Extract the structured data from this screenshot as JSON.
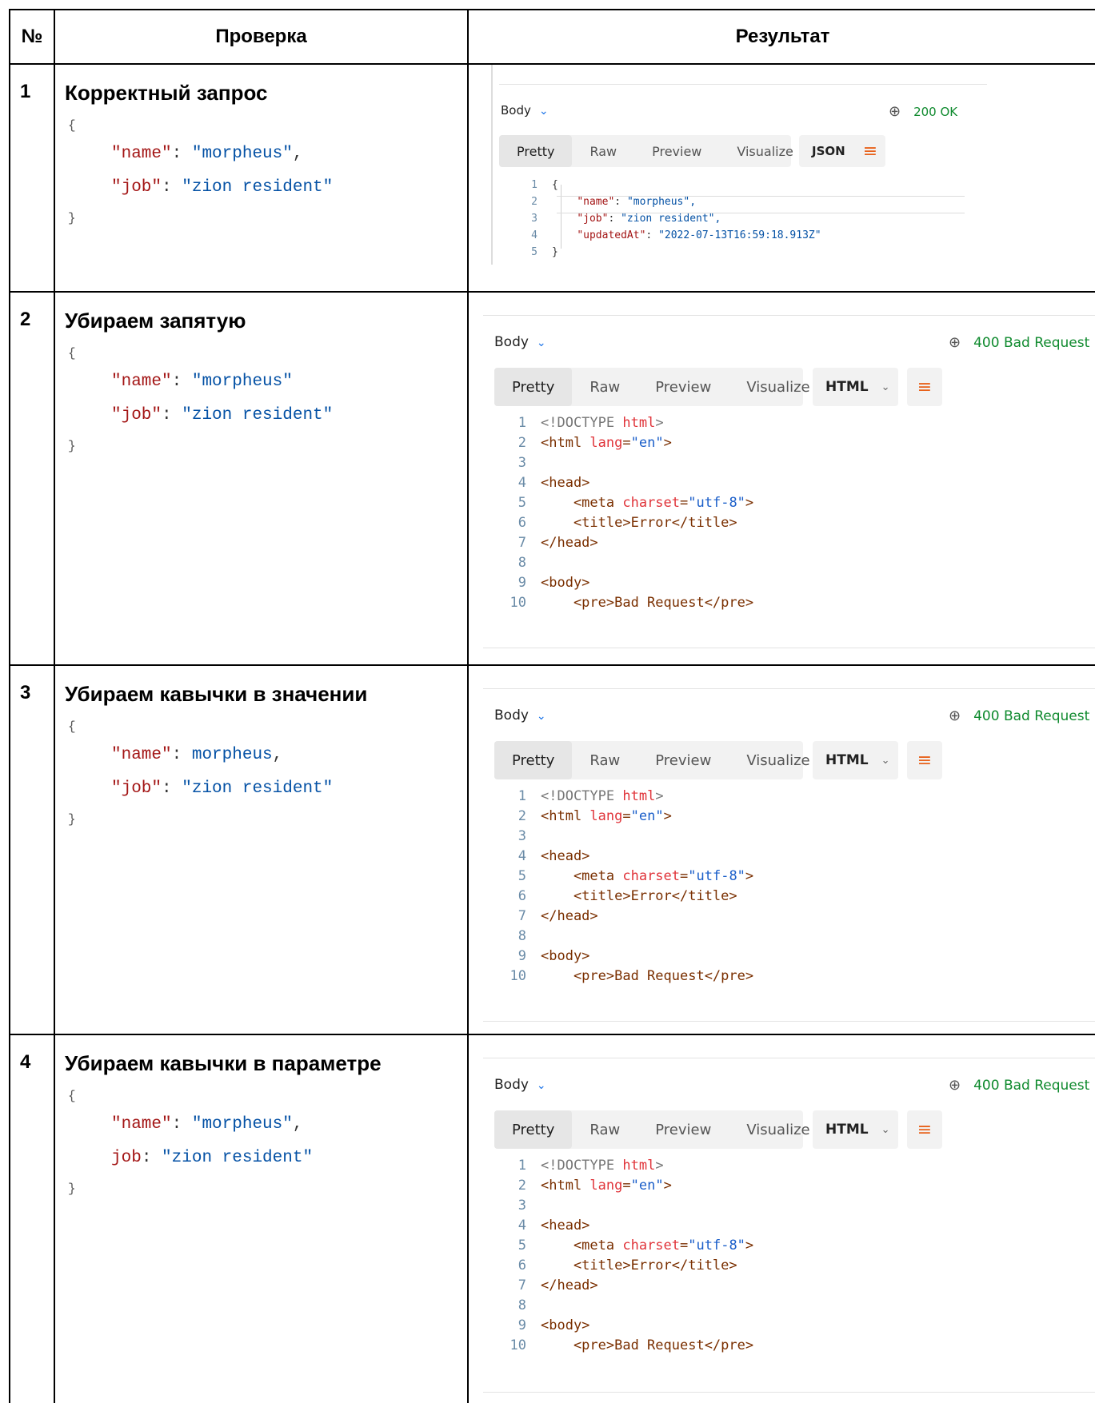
{
  "header": {
    "num": "№",
    "check": "Проверка",
    "result": "Результат"
  },
  "rows": [
    {
      "num": "1",
      "title": "Корректный запрос",
      "json": {
        "open": "{",
        "line1_key": "\"name\"",
        "line1_val": "\"morpheus\"",
        "line1_end": ",",
        "line2_key": "\"job\"",
        "line2_val": "\"zion resident\"",
        "close": "}"
      },
      "panel": {
        "body_label": "Body",
        "status": "200 OK",
        "tabs": [
          "Pretty",
          "Raw",
          "Preview",
          "Visualize"
        ],
        "format": "JSON",
        "lines": [
          {
            "n": "1",
            "t": "{"
          },
          {
            "n": "2",
            "k": "\"name\"",
            "v": "\"morpheus\","
          },
          {
            "n": "3",
            "k": "\"job\"",
            "v": "\"zion resident\","
          },
          {
            "n": "4",
            "k": "\"updatedAt\"",
            "v": "\"2022-07-13T16:59:18.913Z\""
          },
          {
            "n": "5",
            "t": "}"
          }
        ]
      }
    },
    {
      "num": "2",
      "title": "Убираем запятую",
      "json": {
        "open": "{",
        "line1_key": "\"name\"",
        "line1_val": "\"morpheus\"",
        "line1_end": "",
        "line2_key": "\"job\"",
        "line2_val": "\"zion resident\"",
        "close": "}"
      },
      "panel": {
        "body_label": "Body",
        "status": "400 Bad Request",
        "tabs": [
          "Pretty",
          "Raw",
          "Preview",
          "Visualize"
        ],
        "format": "HTML"
      }
    },
    {
      "num": "3",
      "title": "Убираем кавычки в значении",
      "json": {
        "open": "{",
        "line1_key": "\"name\"",
        "line1_val": "morpheus",
        "line1_end": ",",
        "line2_key": "\"job\"",
        "line2_val": "\"zion resident\"",
        "close": "}"
      },
      "panel": {
        "body_label": "Body",
        "status": "400 Bad Request",
        "tabs": [
          "Pretty",
          "Raw",
          "Preview",
          "Visualize"
        ],
        "format": "HTML"
      }
    },
    {
      "num": "4",
      "title": "Убираем кавычки в параметре",
      "json": {
        "open": "{",
        "line1_key": "\"name\"",
        "line1_val": "\"morpheus\"",
        "line1_end": ",",
        "line2_key": "job",
        "line2_val": "\"zion resident\"",
        "close": "}"
      },
      "panel": {
        "body_label": "Body",
        "status": "400 Bad Request",
        "tabs": [
          "Pretty",
          "Raw",
          "Preview",
          "Visualize"
        ],
        "format": "HTML"
      }
    }
  ],
  "html_code": [
    {
      "n": "1",
      "parts": [
        [
          "gray",
          "<!DOCTYPE "
        ],
        [
          "attr",
          "html"
        ],
        [
          "gray",
          ">"
        ]
      ]
    },
    {
      "n": "2",
      "parts": [
        [
          "tag",
          "<html "
        ],
        [
          "attr",
          "lang"
        ],
        [
          "tag",
          "="
        ],
        [
          "str",
          "\"en\""
        ],
        [
          "tag",
          ">"
        ]
      ]
    },
    {
      "n": "3",
      "parts": []
    },
    {
      "n": "4",
      "parts": [
        [
          "tag",
          "<head>"
        ]
      ]
    },
    {
      "n": "5",
      "parts": [
        [
          "tag",
          "    <meta "
        ],
        [
          "attr",
          "charset"
        ],
        [
          "tag",
          "="
        ],
        [
          "str",
          "\"utf-8\""
        ],
        [
          "tag",
          ">"
        ]
      ]
    },
    {
      "n": "6",
      "parts": [
        [
          "tag",
          "    <title>Error</title>"
        ]
      ]
    },
    {
      "n": "7",
      "parts": [
        [
          "tag",
          "</head>"
        ]
      ]
    },
    {
      "n": "8",
      "parts": []
    },
    {
      "n": "9",
      "parts": [
        [
          "tag",
          "<body>"
        ]
      ]
    },
    {
      "n": "10",
      "parts": [
        [
          "tag",
          "    <pre>Bad Request</pre>"
        ]
      ]
    }
  ],
  "icons": {
    "globe": "globe-lock-icon",
    "chevron": "chevron-down-icon",
    "wrap": "wrap-lines-icon"
  }
}
